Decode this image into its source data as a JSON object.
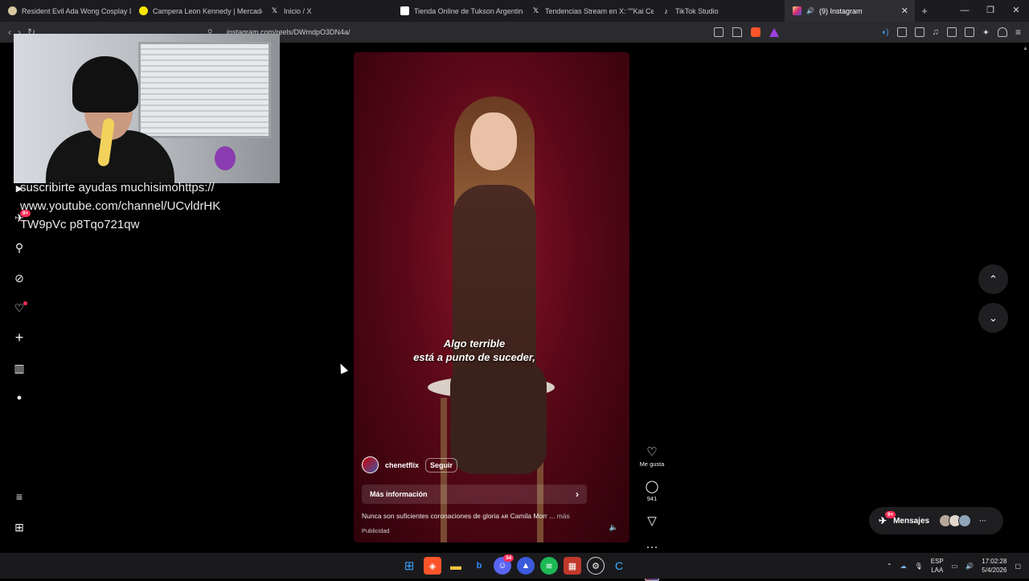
{
  "browser": {
    "tabs": [
      {
        "label": "Resident Evil Ada Wong Cosplay Dis",
        "icon": "circle-icon",
        "color": "#d9c7a0"
      },
      {
        "label": "Campera Leon Kennedy | MercadoLi",
        "icon": "mercadolibre-icon",
        "color": "#ffe600"
      },
      {
        "label": "Inicio / X",
        "icon": "x-icon",
        "color": "#000000"
      },
      {
        "label": "Tienda Online de Tukson Argentina",
        "icon": "page-icon",
        "color": "#ffffff"
      },
      {
        "label": "Tendencias Stream en X: \"\"Kai Cenat",
        "icon": "x-icon",
        "color": "#000000"
      },
      {
        "label": "TikTok Studio",
        "icon": "tiktok-icon",
        "color": "#000000"
      },
      {
        "label": "(9) Instagram",
        "icon": "instagram-icon",
        "color": "#e1306c",
        "active": true
      }
    ],
    "new_tab": "+",
    "url": "instagram.com/reels/DWmdpO3DN4a/"
  },
  "reel": {
    "subtitle_line1": "Algo terrible",
    "subtitle_line2": "está a punto de suceder,",
    "account": "chenetflix",
    "follow_label": "Seguir",
    "info_label": "Más información",
    "caption": "Nunca son suficientes coronaciones de gloria ᴀʀ Camila Morr ...",
    "caption_more": "más",
    "sponsored": "Publicidad",
    "like_label": "Me gusta",
    "comments_count": "941"
  },
  "sidebar": {
    "notifications_badge": "9+"
  },
  "overlay_text": "suscribirte ayudas muchisimohttps://www.youtube.com/channel/UCvldrHKTW9pVc p8Tqo721qw",
  "messages": {
    "label": "Mensajes",
    "badge": "9+"
  },
  "taskbar": {
    "lang_line1": "ESP",
    "lang_line2": "LAA",
    "time": "17:02:28",
    "date": "5/4/2026",
    "discord_badge": "34"
  },
  "colors": {
    "accent_badge": "#ff2d55",
    "reel_bg": "#6a0a1c"
  }
}
